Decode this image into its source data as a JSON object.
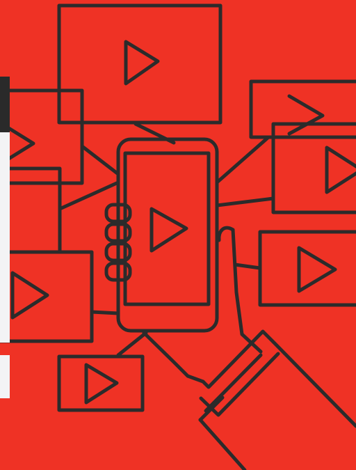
{
  "colors": {
    "background": "#EF3225",
    "stroke": "#2B2B2B",
    "panel_dark": "#2A2A2A",
    "panel_light": "#F3F3F5"
  },
  "icons": [
    "video-frame-icon",
    "play-icon",
    "smartphone-icon",
    "hand-icon"
  ]
}
